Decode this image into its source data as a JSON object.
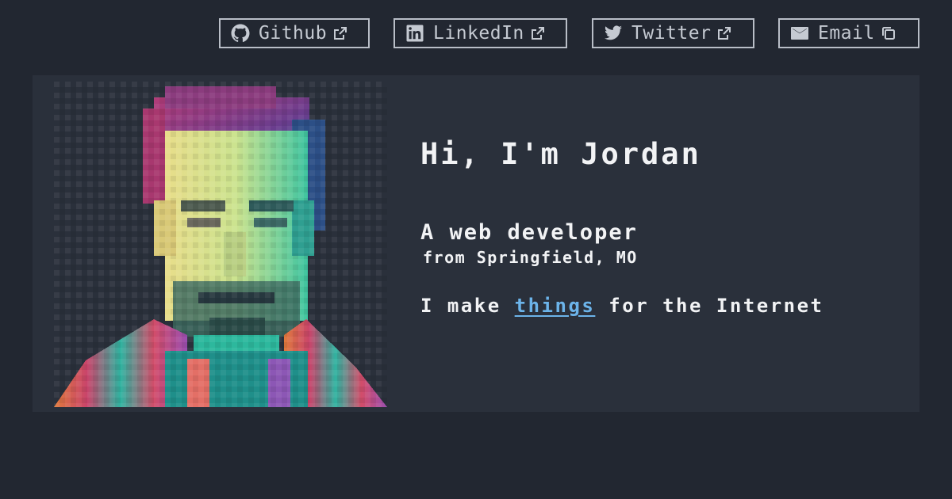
{
  "nav": {
    "github": {
      "label": "Github",
      "icon": "github-icon",
      "trail_icon": "external-link-icon"
    },
    "linkedin": {
      "label": "LinkedIn",
      "icon": "linkedin-icon",
      "trail_icon": "external-link-icon"
    },
    "twitter": {
      "label": "Twitter",
      "icon": "twitter-icon",
      "trail_icon": "external-link-icon"
    },
    "email": {
      "label": "Email",
      "icon": "mail-icon",
      "trail_icon": "copy-icon"
    }
  },
  "hero": {
    "greeting": "Hi, I'm Jordan",
    "role": "A web developer",
    "location": "from Springfield, MO",
    "tagline_before": "I make ",
    "tagline_link": "things",
    "tagline_after": " for the Internet"
  },
  "colors": {
    "background": "#222731",
    "card": "#2a303b",
    "text": "#f2f3f5",
    "link": "#6cb4ea",
    "nav_border": "#b9bec7"
  }
}
